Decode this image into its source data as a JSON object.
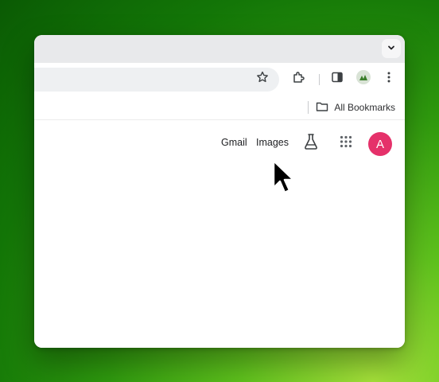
{
  "bookmarks_bar": {
    "all_bookmarks_label": "All Bookmarks",
    "folder_icon": "folder-icon"
  },
  "toolbar": {
    "icons": [
      "star-icon",
      "extensions-icon",
      "side-panel-icon",
      "profile-icon",
      "more-vert-icon"
    ]
  },
  "tabstrip": {
    "tab_search_icon": "chevron-down-icon"
  },
  "google_bar": {
    "gmail_label": "Gmail",
    "images_label": "Images",
    "labs_icon": "flask-icon",
    "apps_icon": "apps-grid-icon",
    "avatar_initial": "A",
    "avatar_color": "#e5316a"
  },
  "colors": {
    "tabstrip_bg": "#e8e9eb",
    "omnibox_bg": "#eef0f2",
    "text": "#202124"
  }
}
